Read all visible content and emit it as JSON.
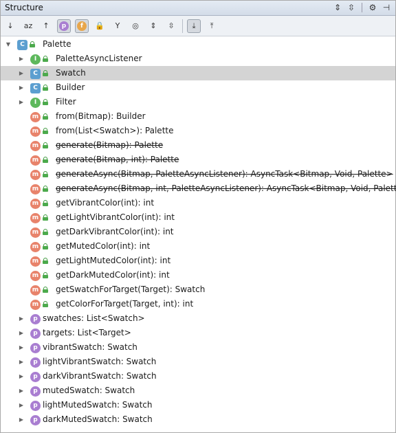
{
  "window": {
    "title": "Structure"
  },
  "title_icons": [
    "expand-all-icon",
    "collapse-all-icon",
    "gear-icon",
    "hide-icon"
  ],
  "toolbar": {
    "buttons": [
      {
        "name": "sort-by-visibility-icon",
        "glyph": "↓",
        "on": false
      },
      {
        "name": "sort-alphabetically-icon",
        "glyph": "az",
        "on": false
      },
      {
        "name": "show-inherited-icon",
        "glyph": "↑",
        "on": false
      },
      {
        "name": "show-properties-icon",
        "glyph": "p",
        "on": true,
        "color": "#a97ed1"
      },
      {
        "name": "show-fields-icon",
        "glyph": "f",
        "on": true,
        "color": "#e8a64b"
      },
      {
        "name": "show-non-public-icon",
        "glyph": "🔒",
        "on": false
      },
      {
        "name": "group-by-type-icon",
        "glyph": "Y",
        "on": false
      },
      {
        "name": "show-anonymous-icon",
        "glyph": "◎",
        "on": false
      },
      {
        "name": "expand-all-icon",
        "glyph": "⇕",
        "on": false
      },
      {
        "name": "collapse-all-icon",
        "glyph": "⇳",
        "on": false
      },
      {
        "name": "autoscroll-to-source-icon",
        "glyph": "⤓",
        "on": true
      },
      {
        "name": "autoscroll-from-source-icon",
        "glyph": "⤒",
        "on": false
      }
    ]
  },
  "tree": [
    {
      "label": "Palette",
      "icon": "class",
      "glyph": "C",
      "depth": 0,
      "arrow": "down",
      "lock": true
    },
    {
      "label": "PaletteAsyncListener",
      "icon": "iface",
      "glyph": "I",
      "depth": 1,
      "arrow": "right",
      "lock": true
    },
    {
      "label": "Swatch",
      "icon": "class",
      "glyph": "C",
      "depth": 1,
      "arrow": "right",
      "lock": true,
      "selected": true
    },
    {
      "label": "Builder",
      "icon": "class",
      "glyph": "C",
      "depth": 1,
      "arrow": "right",
      "lock": true
    },
    {
      "label": "Filter",
      "icon": "iface",
      "glyph": "I",
      "depth": 1,
      "arrow": "right",
      "lock": true
    },
    {
      "label": "from(Bitmap): Builder",
      "icon": "method",
      "glyph": "m",
      "depth": 1,
      "lock": true
    },
    {
      "label": "from(List<Swatch>): Palette",
      "icon": "method",
      "glyph": "m",
      "depth": 1,
      "lock": true
    },
    {
      "label": "generate(Bitmap): Palette",
      "icon": "method",
      "glyph": "m",
      "depth": 1,
      "lock": true,
      "deprecated": true
    },
    {
      "label": "generate(Bitmap, int): Palette",
      "icon": "method",
      "glyph": "m",
      "depth": 1,
      "lock": true,
      "deprecated": true
    },
    {
      "label": "generateAsync(Bitmap, PaletteAsyncListener): AsyncTask<Bitmap, Void, Palette>",
      "icon": "method",
      "glyph": "m",
      "depth": 1,
      "lock": true,
      "deprecated": true
    },
    {
      "label": "generateAsync(Bitmap, int, PaletteAsyncListener): AsyncTask<Bitmap, Void, Palette>",
      "icon": "method",
      "glyph": "m",
      "depth": 1,
      "lock": true,
      "deprecated": true
    },
    {
      "label": "getVibrantColor(int): int",
      "icon": "method",
      "glyph": "m",
      "depth": 1,
      "lock": true
    },
    {
      "label": "getLightVibrantColor(int): int",
      "icon": "method",
      "glyph": "m",
      "depth": 1,
      "lock": true
    },
    {
      "label": "getDarkVibrantColor(int): int",
      "icon": "method",
      "glyph": "m",
      "depth": 1,
      "lock": true
    },
    {
      "label": "getMutedColor(int): int",
      "icon": "method",
      "glyph": "m",
      "depth": 1,
      "lock": true
    },
    {
      "label": "getLightMutedColor(int): int",
      "icon": "method",
      "glyph": "m",
      "depth": 1,
      "lock": true
    },
    {
      "label": "getDarkMutedColor(int): int",
      "icon": "method",
      "glyph": "m",
      "depth": 1,
      "lock": true
    },
    {
      "label": "getSwatchForTarget(Target): Swatch",
      "icon": "method",
      "glyph": "m",
      "depth": 1,
      "lock": true
    },
    {
      "label": "getColorForTarget(Target, int): int",
      "icon": "method",
      "glyph": "m",
      "depth": 1,
      "lock": true
    },
    {
      "label": "swatches: List<Swatch>",
      "icon": "prop",
      "glyph": "p",
      "depth": 1,
      "arrow": "right"
    },
    {
      "label": "targets: List<Target>",
      "icon": "prop",
      "glyph": "p",
      "depth": 1,
      "arrow": "right"
    },
    {
      "label": "vibrantSwatch: Swatch",
      "icon": "prop",
      "glyph": "p",
      "depth": 1,
      "arrow": "right"
    },
    {
      "label": "lightVibrantSwatch: Swatch",
      "icon": "prop",
      "glyph": "p",
      "depth": 1,
      "arrow": "right"
    },
    {
      "label": "darkVibrantSwatch: Swatch",
      "icon": "prop",
      "glyph": "p",
      "depth": 1,
      "arrow": "right"
    },
    {
      "label": "mutedSwatch: Swatch",
      "icon": "prop",
      "glyph": "p",
      "depth": 1,
      "arrow": "right"
    },
    {
      "label": "lightMutedSwatch: Swatch",
      "icon": "prop",
      "glyph": "p",
      "depth": 1,
      "arrow": "right"
    },
    {
      "label": "darkMutedSwatch: Swatch",
      "icon": "prop",
      "glyph": "p",
      "depth": 1,
      "arrow": "right"
    }
  ]
}
